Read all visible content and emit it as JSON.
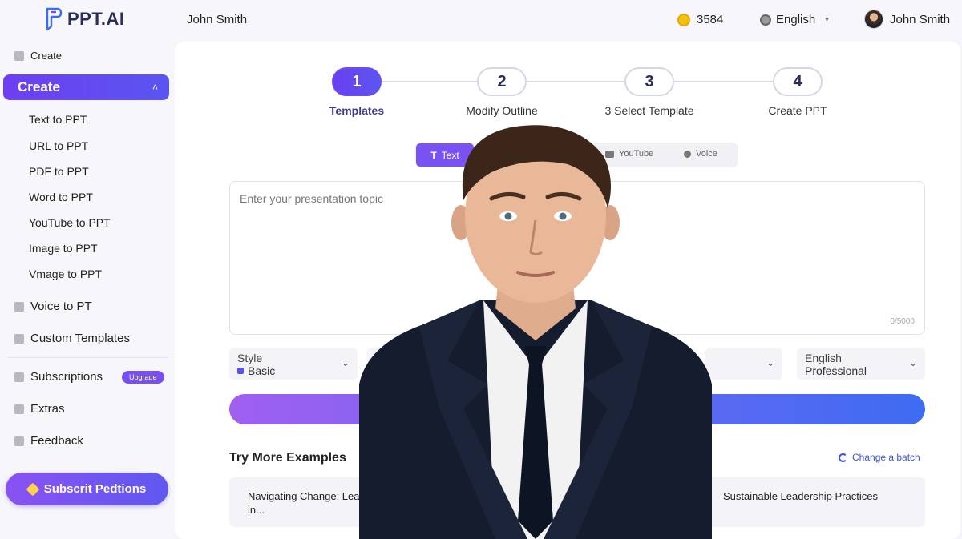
{
  "header": {
    "logo_text": "PPT.AI",
    "user_name_left": "John Smith",
    "credits": "3584",
    "language": "English",
    "user_name_right": "John Smith"
  },
  "sidebar": {
    "create_heading": "Create",
    "active_label": "Create",
    "create_items": [
      "Text to PPT",
      "URL to PPT",
      "PDF to PPT",
      "Word to PPT",
      "YouTube to PPT",
      "Image to PPT",
      "Vmage to PPT"
    ],
    "voice": "Voice to PT",
    "custom_templates": "Custom Templates",
    "subscriptions": "Subscriptions",
    "subscriptions_badge": "Upgrade",
    "extras": "Extras",
    "feedback": "Feedback",
    "subscribe_button": "Subscrit Pedtions"
  },
  "steps": [
    {
      "num": "1",
      "label": "Templates",
      "active": true
    },
    {
      "num": "2",
      "label": "Modify Outline",
      "active": false
    },
    {
      "num": "3",
      "label": "3 Select Template",
      "active": false
    },
    {
      "num": "4",
      "label": "Create PPT",
      "active": false
    }
  ],
  "modes": {
    "text": "Text",
    "youtube": "YouTube",
    "voice": "Voice"
  },
  "topic": {
    "placeholder": "Enter your presentation topic",
    "counter": "0/5000"
  },
  "selects": {
    "style_caption": "Style",
    "style_value": "Basic",
    "lang_caption": "English",
    "lang_value": "Professional"
  },
  "examples": {
    "title": "Try More Examples",
    "change_batch": "Change a batch",
    "cards": [
      "Navigating Change: Leadership in...",
      "Sustainable Leadership Practices"
    ]
  },
  "colors": {
    "accent": "#6a3ef0",
    "accent2": "#3d6cf2",
    "coin": "#f4c20d"
  }
}
